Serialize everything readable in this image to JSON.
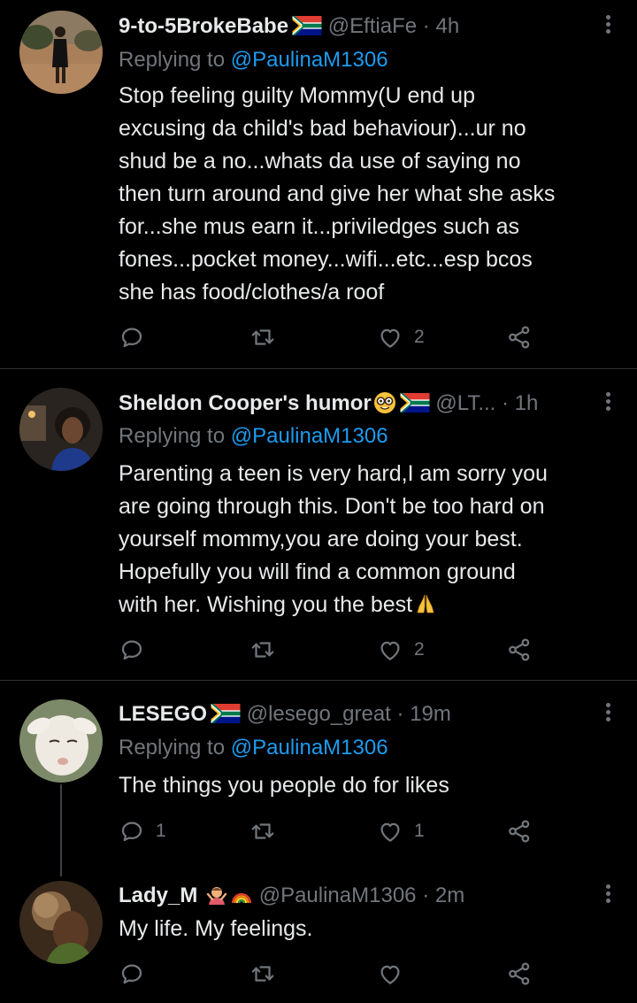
{
  "tweets": [
    {
      "name": "9-to-5BrokeBabe",
      "handle": "@EftiaFe",
      "time": "4h",
      "replying_label": "Replying to",
      "replying_to": "@PaulinaM1306",
      "text_lines": [
        "Stop feeling guilty Mommy(U end up",
        "excusing da child's bad behaviour)...ur no",
        "shud be a no...whats da use of saying no",
        "then turn around and give her what she asks",
        "for...she mus earn it...priviledges such as",
        "fones...pocket money...wifi...etc...esp bcos",
        "she has food/clothes/a roof"
      ],
      "reply_count": "",
      "retweet_count": "",
      "like_count": "2"
    },
    {
      "name": "Sheldon Cooper's humor",
      "handle": "@LT...",
      "time": "1h",
      "replying_label": "Replying to",
      "replying_to": "@PaulinaM1306",
      "text_lines": [
        "Parenting a teen is very hard,I am sorry you",
        "are going through this. Don't be too hard on",
        "yourself mommy,you are doing your best.",
        "Hopefully you will find a common ground",
        "with her. Wishing you the best"
      ],
      "reply_count": "",
      "retweet_count": "",
      "like_count": "2"
    },
    {
      "name": "LESEGO",
      "handle": "@lesego_great",
      "time": "19m",
      "replying_label": "Replying to",
      "replying_to": "@PaulinaM1306",
      "text_lines": [
        "The things you people do for likes"
      ],
      "reply_count": "1",
      "retweet_count": "",
      "like_count": "1"
    },
    {
      "name": "Lady_M",
      "handle": "@PaulinaM1306",
      "time": "2m",
      "text_lines": [
        "My life. My feelings."
      ],
      "reply_count": "",
      "retweet_count": "",
      "like_count": ""
    }
  ],
  "separator": "·",
  "icons": [
    "reply-icon",
    "retweet-icon",
    "like-icon",
    "share-icon",
    "more-icon",
    "south-africa-flag-icon"
  ],
  "colors": {
    "background": "#000000",
    "text": "#e7e9ea",
    "muted": "#71767b",
    "link": "#1d9bf0",
    "divider": "#2f3336"
  }
}
